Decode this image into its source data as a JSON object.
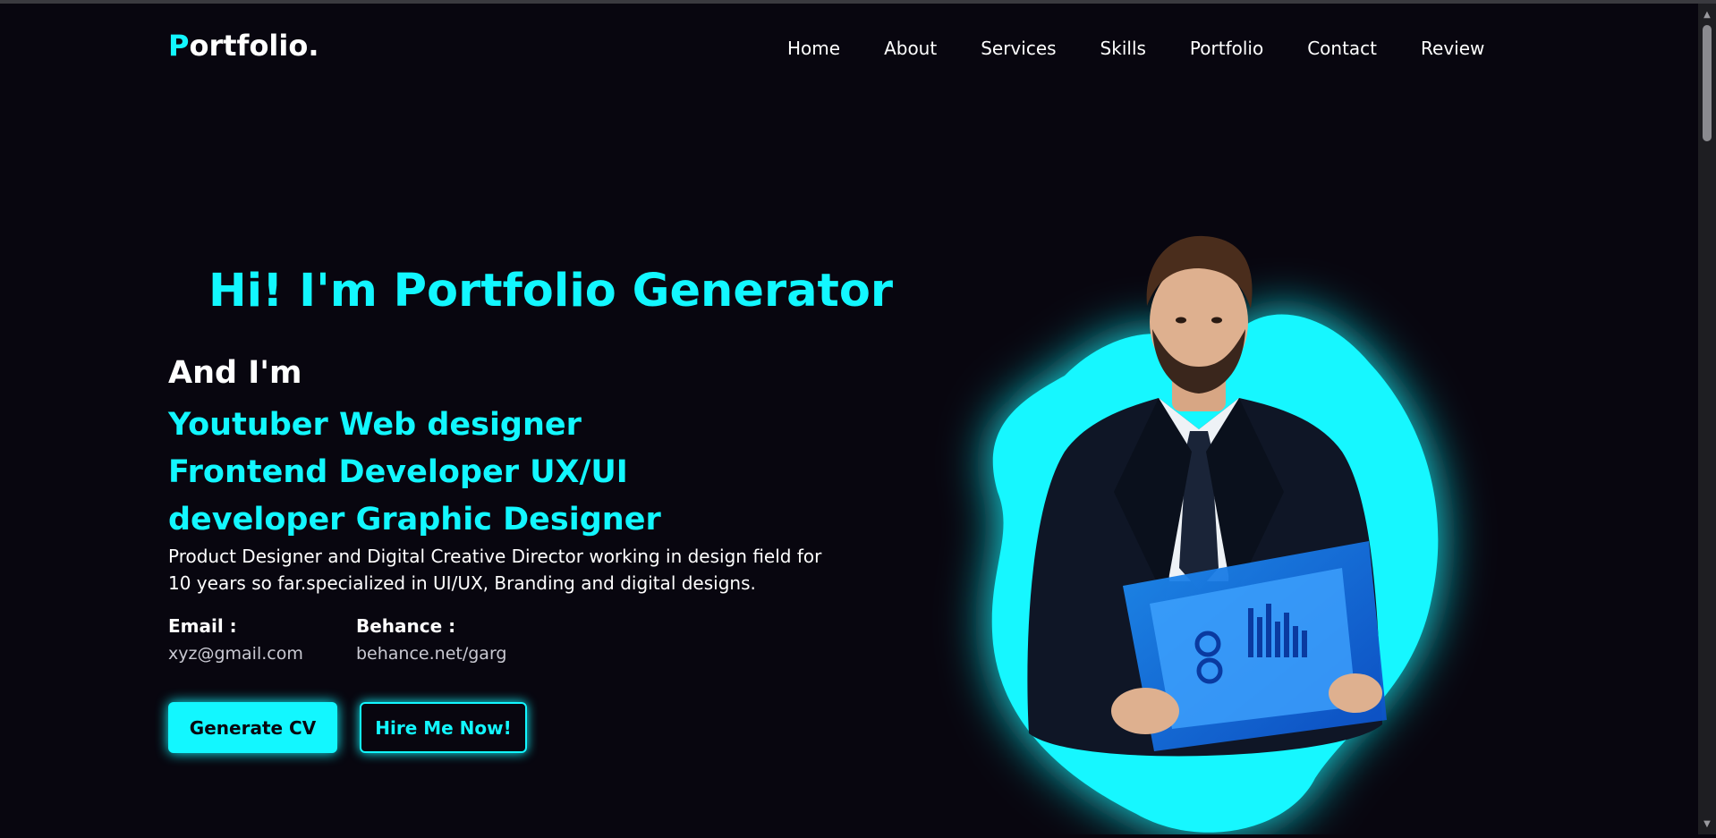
{
  "header": {
    "logo_initial": "P",
    "logo_rest": "ortfolio.",
    "nav": [
      "Home",
      "About",
      "Services",
      "Skills",
      "Portfolio",
      "Contact",
      "Review"
    ]
  },
  "hero": {
    "title": "Hi! I'm Portfolio Generator",
    "and_im": "And I'm",
    "roles": "Youtuber Web designer Frontend Developer UX/UI developer Graphic Designer",
    "description": "Product Designer and Digital Creative Director working in design field for 10 years so far.specialized in UI/UX, Branding and digital designs.",
    "email_label": "Email :",
    "email_value": "xyz@gmail.com",
    "behance_label": "Behance :",
    "behance_value": "behance.net/garg",
    "primary_button": "Generate CV",
    "secondary_button": "Hire Me Now!"
  },
  "colors": {
    "accent": "#12f7ff",
    "background": "#08060f",
    "text": "#ffffff"
  },
  "icons": {
    "scroll_up": "scroll-up-arrow-icon",
    "scroll_down": "scroll-down-arrow-icon"
  }
}
